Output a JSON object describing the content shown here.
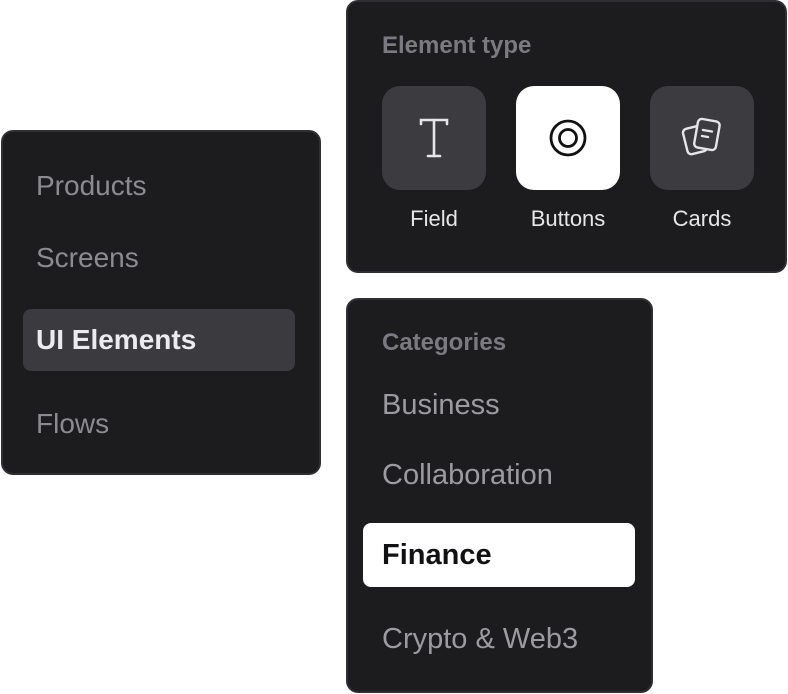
{
  "nav": {
    "items": [
      {
        "label": "Products",
        "active": false
      },
      {
        "label": "Screens",
        "active": false
      },
      {
        "label": "UI Elements",
        "active": true
      },
      {
        "label": "Flows",
        "active": false
      }
    ]
  },
  "element_type": {
    "heading": "Element type",
    "options": [
      {
        "label": "Field",
        "icon": "text-cursor-icon",
        "selected": false
      },
      {
        "label": "Buttons",
        "icon": "target-icon",
        "selected": true
      },
      {
        "label": "Cards",
        "icon": "cards-icon",
        "selected": false
      }
    ]
  },
  "categories": {
    "heading": "Categories",
    "items": [
      {
        "label": "Business",
        "active": false
      },
      {
        "label": "Collaboration",
        "active": false
      },
      {
        "label": "Finance",
        "active": true
      },
      {
        "label": "Crypto & Web3",
        "active": false
      }
    ]
  },
  "colors": {
    "panel_bg": "#1c1c1e",
    "panel_border": "#2f2f33",
    "active_nav_bg": "#3a3a3f",
    "selected_bg": "#ffffff",
    "muted_text": "#8b8b90"
  }
}
